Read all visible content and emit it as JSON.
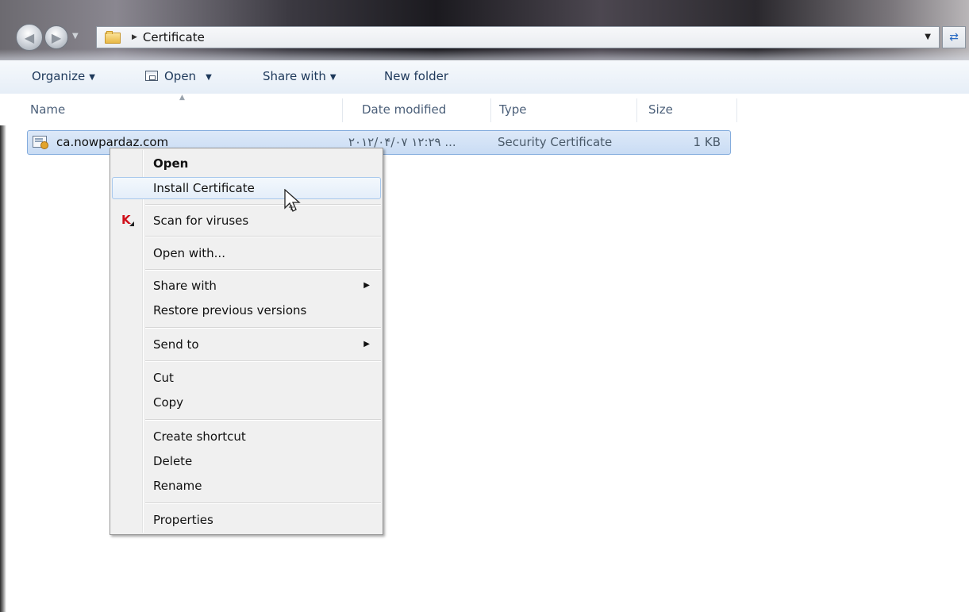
{
  "window": {
    "breadcrumb": [
      "Certificate"
    ]
  },
  "toolbar": {
    "organize": "Organize",
    "open": "Open",
    "share_with": "Share with",
    "new_folder": "New folder"
  },
  "columns": [
    "Name",
    "Date modified",
    "Type",
    "Size"
  ],
  "files": [
    {
      "name": "ca.nowpardaz.com",
      "date_modified": "۲۰۱۲/۰۴/۰۷ ۱۲:۲۹ ...",
      "type": "Security Certificate",
      "size": "1 KB",
      "icon": "certificate-icon"
    }
  ],
  "context_menu": {
    "items": [
      {
        "label": "Open",
        "bold": true
      },
      {
        "label": "Install Certificate",
        "highlighted": true
      },
      {
        "label": "Scan for viruses",
        "icon": "kaspersky-icon"
      },
      {
        "label": "Open with..."
      },
      {
        "label": "Share with",
        "submenu": true
      },
      {
        "label": "Restore previous versions"
      },
      {
        "label": "Send to",
        "submenu": true
      },
      {
        "label": "Cut"
      },
      {
        "label": "Copy"
      },
      {
        "label": "Create shortcut"
      },
      {
        "label": "Delete"
      },
      {
        "label": "Rename"
      },
      {
        "label": "Properties"
      }
    ]
  },
  "colors": {
    "toolbar_text": "#1e395b",
    "selection_bg": "#c9dcf4",
    "selection_border": "#84acdd",
    "menu_bg": "#f0f0f0"
  }
}
